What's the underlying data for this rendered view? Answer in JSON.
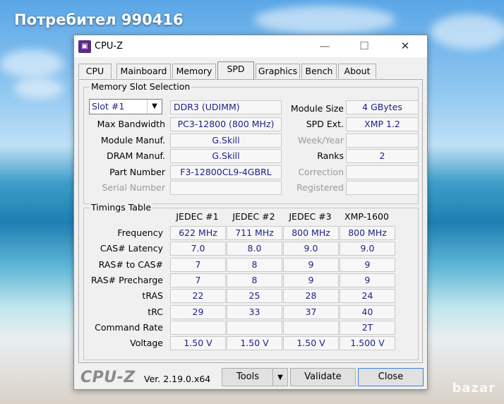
{
  "background": {
    "title": "Потребител 990416",
    "watermark": "bazar"
  },
  "window": {
    "title": "CPU-Z",
    "minimize_icon": "minimize-icon",
    "maximize_icon": "maximize-icon",
    "close_icon": "close-icon"
  },
  "tabs": [
    "CPU",
    "Mainboard",
    "Memory",
    "SPD",
    "Graphics",
    "Bench",
    "About"
  ],
  "active_tab": "SPD",
  "slot": {
    "group_label": "Memory Slot Selection",
    "selected": "Slot #1",
    "type": "DDR3 (UDIMM)",
    "labels": {
      "max_bandwidth": "Max Bandwidth",
      "module_manuf": "Module Manuf.",
      "dram_manuf": "DRAM Manuf.",
      "part_number": "Part Number",
      "serial_number": "Serial Number",
      "module_size": "Module Size",
      "spd_ext": "SPD Ext.",
      "week_year": "Week/Year",
      "ranks": "Ranks",
      "correction": "Correction",
      "registered": "Registered"
    },
    "values": {
      "max_bandwidth": "PC3-12800 (800 MHz)",
      "module_manuf": "G.Skill",
      "dram_manuf": "G.Skill",
      "part_number": "F3-12800CL9-4GBRL",
      "serial_number": "",
      "module_size": "4 GBytes",
      "spd_ext": "XMP 1.2",
      "week_year": "",
      "ranks": "2",
      "correction": "",
      "registered": ""
    }
  },
  "timings": {
    "group_label": "Timings Table",
    "columns": [
      "JEDEC #1",
      "JEDEC #2",
      "JEDEC #3",
      "XMP-1600"
    ],
    "rows": [
      {
        "label": "Frequency",
        "values": [
          "622 MHz",
          "711 MHz",
          "800 MHz",
          "800 MHz"
        ]
      },
      {
        "label": "CAS# Latency",
        "values": [
          "7.0",
          "8.0",
          "9.0",
          "9.0"
        ]
      },
      {
        "label": "RAS# to CAS#",
        "values": [
          "7",
          "8",
          "9",
          "9"
        ]
      },
      {
        "label": "RAS# Precharge",
        "values": [
          "7",
          "8",
          "9",
          "9"
        ]
      },
      {
        "label": "tRAS",
        "values": [
          "22",
          "25",
          "28",
          "24"
        ]
      },
      {
        "label": "tRC",
        "values": [
          "29",
          "33",
          "37",
          "40"
        ]
      },
      {
        "label": "Command Rate",
        "values": [
          "",
          "",
          "",
          "2T"
        ]
      },
      {
        "label": "Voltage",
        "values": [
          "1.50 V",
          "1.50 V",
          "1.50 V",
          "1.500 V"
        ]
      }
    ]
  },
  "footer": {
    "logo": "CPU-Z",
    "version": "Ver. 2.19.0.x64",
    "tools_label": "Tools",
    "validate_label": "Validate",
    "close_label": "Close"
  },
  "colors": {
    "value_text": "#1e1e8c",
    "dim_label": "#9a9a9a"
  }
}
